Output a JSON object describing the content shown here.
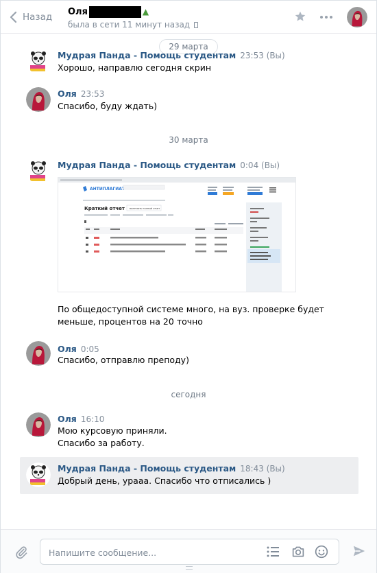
{
  "header": {
    "back_label": "Назад",
    "peer_name": "Оля",
    "peer_status": "была в сети 11 минут назад"
  },
  "dates": {
    "d1": "29 марта",
    "d2": "30 марта",
    "d3": "сегодня"
  },
  "messages": [
    {
      "author": "Мудрая Панда - Помощь студентам",
      "time": "23:53 (Вы)",
      "lines": [
        "Хорошо, направлю сегодня скрин"
      ]
    },
    {
      "author": "Оля",
      "time": "23:53",
      "lines": [
        "Спасибо, буду ждать)"
      ]
    },
    {
      "author": "Мудрая Панда - Помощь студентам",
      "time": "0:04 (Вы)",
      "lines": [
        "По общедоступной системе много, на вуз. проверке будет",
        "меньше, процентов на 20 точно"
      ]
    },
    {
      "author": "Оля",
      "time": "0:05",
      "lines": [
        "Спасибо, отправлю преподу)"
      ]
    },
    {
      "author": "Оля",
      "time": "16:10",
      "lines": [
        "Мою курсовую приняли.",
        "Спасибо за работу."
      ]
    },
    {
      "author": "Мудрая Панда - Помощь студентам",
      "time": "18:43 (Вы)",
      "lines": [
        "Добрый день, урааа. Спасибо что отписались )"
      ]
    }
  ],
  "attachment": {
    "logo_text": "АНТИПЛАГИАТ",
    "report_title": "Краткий отчет",
    "report_button": "ВЫГРУЗИТЬ ПОЛНЫЙ ОТЧЕТ"
  },
  "composer": {
    "placeholder": "Напишите сообщение..."
  },
  "colors": {
    "link_blue": "#2a5885",
    "muted": "#818c99",
    "highlight_bg": "#edeef0"
  }
}
